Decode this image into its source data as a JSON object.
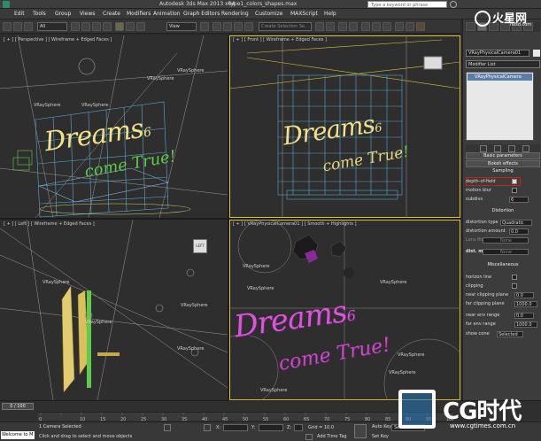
{
  "titlebar": {
    "app_title": "Autodesk 3ds Max  2013 x64",
    "file_name": "type1_colors_shapes.max",
    "search_placeholder": "Type a keyword or phrase"
  },
  "menubar": {
    "items": [
      "Edit",
      "Tools",
      "Group",
      "Views",
      "Create",
      "Modifiers",
      "Animation",
      "Graph Editors",
      "Rendering",
      "Customize",
      "MAXScript",
      "Help"
    ]
  },
  "toolbar": {
    "filter_select": "All",
    "view_select": "View",
    "selection_set": "Create Selection Se..."
  },
  "viewports": {
    "perspective_label": "[ + ] [ Perspective ] [ Wireframe + Edged Faces ]",
    "front_label": "[ + ] [ Front ] [ Wireframe + Edged Faces ]",
    "left_label": "[ + ] [ Left ] [ Wireframe + Edged Faces ]",
    "camera_label": "[ + ] [ VRayPhysicalCamera01 ] [ Smooth + Highlights ]",
    "object_label": "VRaySphere",
    "vray_sphere_count": 14,
    "viewcube_left": "LEFT"
  },
  "scene_text": {
    "line1": "Dreams",
    "line2": "come True",
    "small_number": "6",
    "exclaim": "!"
  },
  "command_panel": {
    "object_name": "VRayPhysicalCamera01",
    "modifier_list": "Modifier List",
    "stack_item": "VRayPhysicalCamera",
    "rollout_basic": "Basic parameters",
    "rollout_bokeh": "Bokeh effects",
    "rollout_sampling": "Sampling",
    "depth_of_field": "depth-of-field",
    "motion_blur": "motion blur",
    "subdivs": "subdivs",
    "subdivs_value": "6",
    "rollout_distortion": "Distortion",
    "distortion_type": "distortion type",
    "distortion_type_value": "Quadratic",
    "distortion_amount": "distortion amount",
    "distortion_amount_value": "0.0",
    "lens_file": "Lens file",
    "lens_file_value": "None",
    "dist_map": "dist. map",
    "dist_map_value": "None",
    "rollout_misc": "Miscellaneous",
    "horizon_line": "horizon line",
    "clipping": "clipping",
    "near_clipping_plane": "near clipping plane",
    "near_clipping_plane_value": "0.0",
    "far_clipping_plane": "far clipping plane",
    "far_clipping_plane_value": "1000.0",
    "near_env_range": "near env range",
    "near_env_range_value": "0.0",
    "far_env_range": "far env range",
    "far_env_range_value": "1000.0",
    "show_cone": "show cone",
    "show_cone_value": "Selected"
  },
  "timeline": {
    "frame_display": "0 / 100",
    "ticks": [
      "0",
      "10",
      "15",
      "20",
      "25",
      "30",
      "35",
      "40",
      "45",
      "50",
      "55",
      "60",
      "65",
      "70",
      "75",
      "80",
      "85",
      "90",
      "95",
      "100"
    ],
    "progress": 0.0
  },
  "statusbar": {
    "maxscript_prompt": "Welcome to M",
    "selection_status": "1 Camera Selected",
    "prompt": "Click and drag to select and move objects",
    "x_label": "X:",
    "y_label": "Y:",
    "z_label": "Z:",
    "grid": "Grid = 10.0",
    "autokey": "Auto Key",
    "setkey": "Set Key",
    "key_filter": "Selected",
    "add_time_tag": "Add Time Tag"
  },
  "watermarks": {
    "top": "火星网",
    "top_sub": "hxsd.com",
    "bottom": "CG时代",
    "bottom_sub": "www.cgtimes.com.cn"
  },
  "colors": {
    "viewport_bg": "#2e2e2e",
    "active_border": "#d9c33a",
    "wire_blue": "#6ec3e6",
    "text_gold": "#f0e18a",
    "text_gold_dark": "#c9a64b",
    "pink": "#d857d8",
    "green": "#5ecb4a",
    "stack_bg": "#e8e8e8",
    "stack_sel": "#5b7da8",
    "dof_highlight": "#d01d1d"
  }
}
